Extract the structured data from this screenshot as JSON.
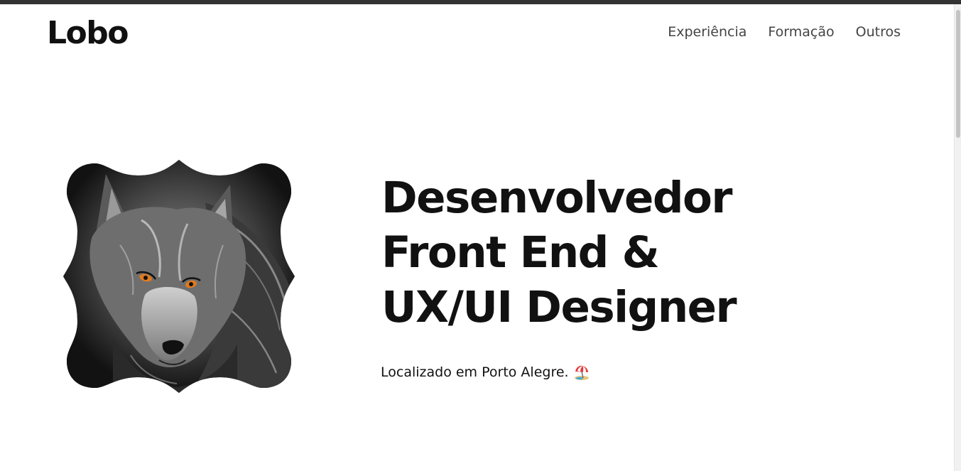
{
  "header": {
    "logo": "Lobo",
    "nav": [
      {
        "label": "Experiência"
      },
      {
        "label": "Formação"
      },
      {
        "label": "Outros"
      }
    ]
  },
  "hero": {
    "headline_lines": [
      "Desenvolvedor",
      "Front End &",
      "UX/UI Designer"
    ],
    "location": "Localizado em Porto Alegre.",
    "location_icon": "beach-umbrella-icon",
    "portrait": "wolf-portrait"
  },
  "colors": {
    "top_bar": "#333333",
    "text": "#111111",
    "nav_text": "#444444",
    "wolf_eye": "#e07a1c"
  }
}
